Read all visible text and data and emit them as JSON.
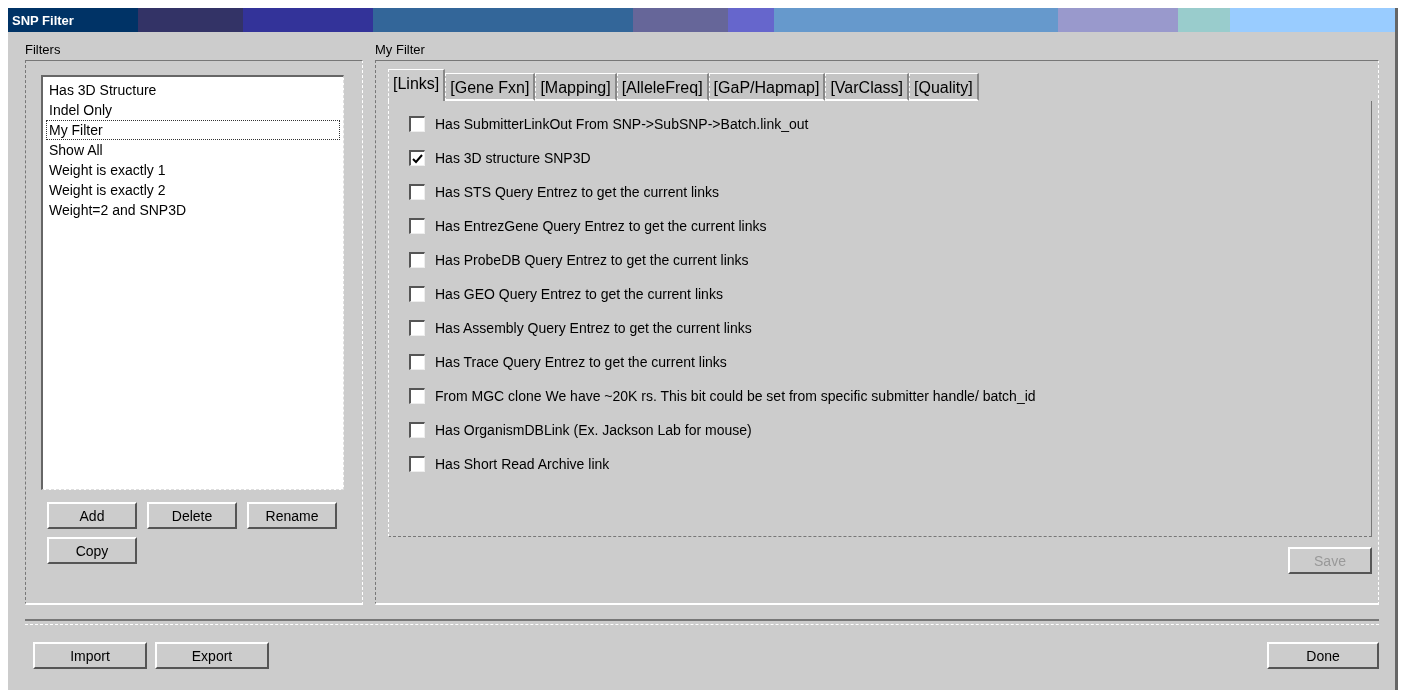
{
  "window": {
    "title": "SNP Filter"
  },
  "filters": {
    "label": "Filters",
    "items": [
      {
        "label": "Has 3D Structure",
        "selected": false
      },
      {
        "label": "Indel Only",
        "selected": false
      },
      {
        "label": "My Filter",
        "selected": true
      },
      {
        "label": "Show All",
        "selected": false
      },
      {
        "label": "Weight is exactly 1",
        "selected": false
      },
      {
        "label": "Weight is exactly 2",
        "selected": false
      },
      {
        "label": "Weight=2 and SNP3D",
        "selected": false
      }
    ],
    "buttons": [
      "Add",
      "Delete",
      "Rename",
      "Copy"
    ]
  },
  "editor": {
    "label": "My Filter",
    "tabs": [
      {
        "label": "[Links]",
        "selected": true
      },
      {
        "label": "[Gene Fxn]",
        "selected": false
      },
      {
        "label": "[Mapping]",
        "selected": false
      },
      {
        "label": "[AlleleFreq]",
        "selected": false
      },
      {
        "label": "[GaP/Hapmap]",
        "selected": false
      },
      {
        "label": "[VarClass]",
        "selected": false
      },
      {
        "label": "[Quality]",
        "selected": false
      }
    ],
    "options": [
      {
        "label": "Has SubmitterLinkOut From SNP->SubSNP->Batch.link_out",
        "checked": false
      },
      {
        "label": "Has 3D structure SNP3D",
        "checked": true
      },
      {
        "label": "Has STS Query Entrez to get the current links",
        "checked": false
      },
      {
        "label": "Has EntrezGene Query Entrez to get the current links",
        "checked": false
      },
      {
        "label": "Has ProbeDB Query Entrez to get the current links",
        "checked": false
      },
      {
        "label": "Has GEO Query Entrez to get the current links",
        "checked": false
      },
      {
        "label": "Has Assembly Query Entrez to get the current links",
        "checked": false
      },
      {
        "label": "Has Trace Query Entrez to get the current links",
        "checked": false
      },
      {
        "label": "From MGC clone We have ~20K rs. This bit could be set from specific submitter handle/ batch_id",
        "checked": false
      },
      {
        "label": "Has OrganismDBLink (Ex. Jackson Lab for mouse)",
        "checked": false
      },
      {
        "label": "Has Short Read Archive link",
        "checked": false
      }
    ],
    "save": {
      "label": "Save",
      "disabled": true
    }
  },
  "footer": {
    "left_buttons": [
      "Import",
      "Export"
    ],
    "right_buttons": [
      "Done"
    ]
  }
}
